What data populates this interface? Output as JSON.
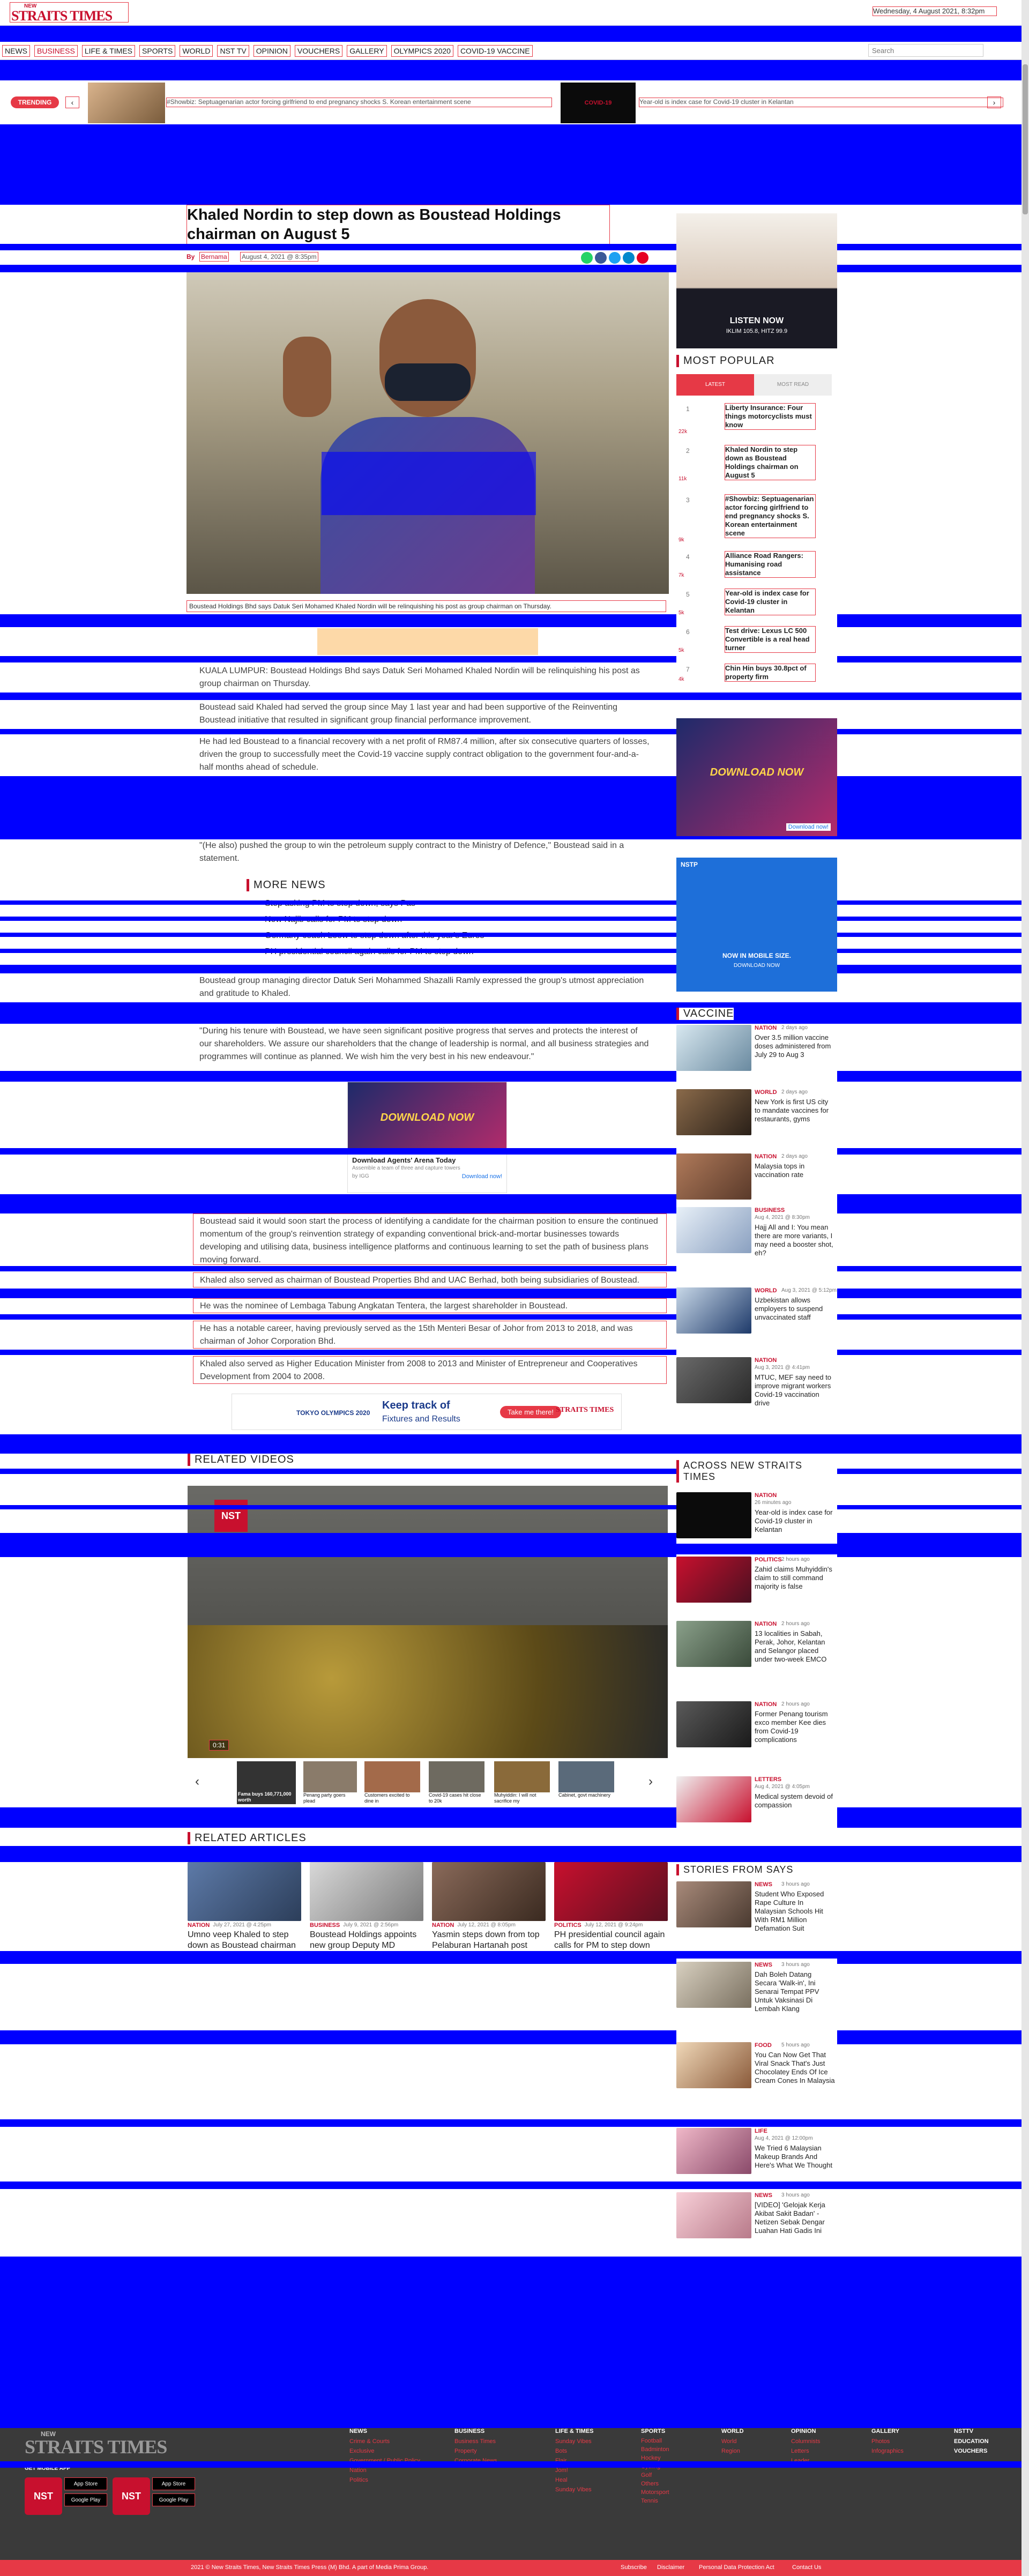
{
  "header": {
    "logo_top": "NEW",
    "logo_main": "STRAITS TIMES",
    "date": "Wednesday, 4 August 2021, 8:32pm"
  },
  "nav": {
    "items": [
      "NEWS",
      "BUSINESS",
      "LIFE & TIMES",
      "SPORTS",
      "WORLD",
      "NST TV",
      "OPINION",
      "VOUCHERS",
      "GALLERY",
      "OLYMPICS 2020",
      "COVID-19 VACCINE"
    ],
    "search_placeholder": "Search"
  },
  "trending": {
    "label": "TRENDING",
    "item1": "#Showbiz: Septuagenarian actor forcing girlfriend to end pregnancy shocks S. Korean entertainment scene",
    "item2": "Year-old is index case for Covid-19 cluster in Kelantan"
  },
  "article": {
    "title": "Khaled Nordin to step down as Boustead Holdings chairman on August 5",
    "byline_label": "By",
    "byline_author": "Bernama",
    "date": "August 4, 2021 @ 8:35pm",
    "caption": "Boustead Holdings Bhd says Datuk Seri Mohamed Khaled Nordin will be relinquishing his post as group chairman on Thursday.",
    "p1": "KUALA LUMPUR: Boustead Holdings Bhd says Datuk Seri Mohamed Khaled Nordin will be relinquishing his post as group chairman on Thursday.",
    "p2": "Boustead said Khaled had served the group since May 1 last year and had been supportive of the Reinventing Boustead initiative that resulted in significant group financial performance improvement.",
    "p3": "He had led Boustead to a financial recovery with a net profit of RM87.4 million, after six consecutive quarters of losses, driven the group to successfully meet the Covid-19 vaccine supply contract obligation to the government four-and-a-half months ahead of schedule.",
    "p4": "\"(He also) pushed the group to win the petroleum supply contract to the Ministry of Defence,\" Boustead said in a statement.",
    "p5": "Boustead group managing director Datuk Seri Mohammed Shazalli Ramly expressed the group's utmost appreciation and gratitude to Khaled.",
    "p6": "\"During his tenure with Boustead, we have seen significant positive progress that serves and protects the interest of our shareholders. We assure our shareholders that the change of leadership is normal, and all business strategies and programmes will continue as planned. We wish him the very best in his new endeavour.\"",
    "p7": "Boustead said it would soon start the process of identifying a candidate for the chairman position to ensure the continued momentum of the group's reinvention strategy of expanding conventional brick-and-mortar businesses towards developing and utilising data, business intelligence platforms and continuous learning to set the path of business plans moving forward.",
    "p8": "Khaled also served as chairman of Boustead Properties Bhd and UAC Berhad, both being subsidiaries of Boustead.",
    "p9": "He was the nominee of Lembaga Tabung Angkatan Tentera, the largest shareholder in Boustead.",
    "p10": "He has a notable career, having previously served as the 15th Menteri Besar of Johor from 2013 to 2018, and was chairman of Johor Corporation Bhd.",
    "p11": "Khaled also served as Higher Education Minister from 2008 to 2013 and Minister of Entrepreneur and Cooperatives Development from 2004 to 2008."
  },
  "more_news": {
    "title": "MORE NEWS",
    "items": [
      "Stop asking PM to step down, says Pas",
      "Now Najib calls for PM to step down",
      "Germany coach Loew to step down after this year's Euros",
      "PH presidential council again calls for PM to step down"
    ]
  },
  "ad_game": {
    "title": "Download Agents' Arena Today",
    "sub": "Assemble a team of three and capture towers",
    "brand": "by IGG",
    "cta": "Download now!",
    "banner": "DOWNLOAD NOW"
  },
  "olympics_banner": {
    "text1": "TOKYO OLYMPICS 2020",
    "text2": "Keep track of",
    "text3": "Fixtures and Results",
    "cta": "Take me there!"
  },
  "related_videos": {
    "title": "RELATED VIDEOS",
    "video_time": "0:31",
    "thumbs": [
      "Fama buys 160,771,000 worth",
      "Penang party goers plead",
      "Customers excited to dine in",
      "Covid-19 cases hit close to 20k",
      "Muhyiddin: I will not sacrifice my",
      "Cabinet, govt machinery"
    ]
  },
  "related_articles": {
    "title": "RELATED ARTICLES",
    "items": [
      {
        "cat": "NATION",
        "date": "July 27, 2021 @ 4:25pm",
        "title": "Umno veep Khaled to step down as Boustead chairman"
      },
      {
        "cat": "BUSINESS",
        "date": "July 9, 2021 @ 2:56pm",
        "title": "Boustead Holdings appoints new group Deputy MD"
      },
      {
        "cat": "NATION",
        "date": "July 12, 2021 @ 8:05pm",
        "title": "Yasmin steps down from top Pelaburan Hartanah post"
      },
      {
        "cat": "POLITICS",
        "date": "July 12, 2021 @ 9:24pm",
        "title": "PH presidential council again calls for PM to step down"
      }
    ]
  },
  "sidebar": {
    "listen_title": "LISTEN NOW",
    "listen_sub": "IKLIM 105.8, HITZ 99.9",
    "most_popular": {
      "title": "MOST POPULAR",
      "tab1": "LATEST",
      "tab2": "MOST READ",
      "items": [
        {
          "n": "1",
          "views": "22k",
          "title": "Liberty Insurance: Four things motorcyclists must know"
        },
        {
          "n": "2",
          "views": "11k",
          "title": "Khaled Nordin to step down as Boustead Holdings chairman on August 5"
        },
        {
          "n": "3",
          "views": "9k",
          "title": "#Showbiz: Septuagenarian actor forcing girlfriend to end pregnancy shocks S. Korean entertainment scene"
        },
        {
          "n": "4",
          "views": "7k",
          "title": "Alliance Road Rangers: Humanising road assistance"
        },
        {
          "n": "5",
          "views": "5k",
          "title": "Year-old is index case for Covid-19 cluster in Kelantan"
        },
        {
          "n": "6",
          "views": "5k",
          "title": "Test drive: Lexus LC 500 Convertible is a real head turner"
        },
        {
          "n": "7",
          "views": "4k",
          "title": "Chin Hin buys 30.8pct of property firm"
        }
      ]
    },
    "nstp_ad": {
      "line1": "NOW IN MOBILE SIZE.",
      "line2": "DOWNLOAD NOW",
      "brand": "NSTP"
    },
    "vaccine": {
      "title": "VACCINE",
      "items": [
        {
          "cat": "NATION",
          "date": "2 days ago",
          "title": "Over 3.5 million vaccine doses administered from July 29 to Aug 3"
        },
        {
          "cat": "WORLD",
          "date": "2 days ago",
          "title": "New York is first US city to mandate vaccines for restaurants, gyms"
        },
        {
          "cat": "NATION",
          "date": "2 days ago",
          "title": "Malaysia tops in vaccination rate"
        },
        {
          "cat": "BUSINESS",
          "date": "Aug 4, 2021 @ 8:30pm",
          "title": "Hajj All and I: You mean there are more variants, I may need a booster shot, eh?"
        },
        {
          "cat": "WORLD",
          "date": "Aug 3, 2021 @ 5:12pm",
          "title": "Uzbekistan allows employers to suspend unvaccinated staff"
        },
        {
          "cat": "NATION",
          "date": "Aug 3, 2021 @ 4:41pm",
          "title": "MTUC, MEF say need to improve migrant workers Covid-19 vaccination drive"
        }
      ]
    },
    "across": {
      "title": "ACROSS NEW STRAITS TIMES",
      "items": [
        {
          "cat": "NATION",
          "date": "26 minutes ago",
          "title": "Year-old is index case for Covid-19 cluster in Kelantan"
        },
        {
          "cat": "POLITICS",
          "date": "2 hours ago",
          "title": "Zahid claims Muhyiddin's claim to still command majority is false"
        },
        {
          "cat": "NATION",
          "date": "2 hours ago",
          "title": "13 localities in Sabah, Perak, Johor, Kelantan and Selangor placed under two-week EMCO"
        },
        {
          "cat": "NATION",
          "date": "2 hours ago",
          "title": "Former Penang tourism exco member Kee dies from Covid-19 complications"
        },
        {
          "cat": "LETTERS",
          "date": "Aug 4, 2021 @ 4:05pm",
          "title": "Medical system devoid of compassion"
        }
      ]
    },
    "stories": {
      "title": "STORIES FROM SAYS",
      "items": [
        {
          "cat": "NEWS",
          "date": "3 hours ago",
          "title": "Student Who Exposed Rape Culture In Malaysian Schools Hit With RM1 Million Defamation Suit"
        },
        {
          "cat": "NEWS",
          "date": "3 hours ago",
          "title": "Dah Boleh Datang Secara 'Walk-in', Ini Senarai Tempat PPV Untuk Vaksinasi Di Lembah Klang"
        },
        {
          "cat": "FOOD",
          "date": "5 hours ago",
          "title": "You Can Now Get That Viral Snack That's Just Chocolatey Ends Of Ice Cream Cones In Malaysia"
        },
        {
          "cat": "LIFE",
          "date": "Aug 4, 2021 @ 12:00pm",
          "title": "We Tried 6 Malaysian Makeup Brands And Here's What We Thought"
        },
        {
          "cat": "NEWS",
          "date": "3 hours ago",
          "title": "[VIDEO] 'Gelojak Kerja Akibat Sakit Badan' - Netizen Sebak Dengar Luahan Hati Gadis Ini"
        }
      ]
    }
  },
  "footer": {
    "logo_top": "NEW",
    "logo_main": "STRAITS TIMES",
    "get_mobile": "GET MOBILE APP",
    "cols": [
      {
        "head": "NEWS",
        "items": [
          "Crime & Courts",
          "Exclusive",
          "Government / Public Policy",
          "Nation",
          "Politics"
        ]
      },
      {
        "head": "BUSINESS",
        "items": [
          "Business Times",
          "Property",
          "Corporate News"
        ]
      },
      {
        "head": "LIFE & TIMES",
        "items": [
          "Sunday Vibes",
          "Bots",
          "Flair",
          "Jom!",
          "Heal",
          "Sunday Vibes"
        ]
      },
      {
        "head": "SPORTS",
        "items": [
          "Football",
          "Badminton",
          "Hockey",
          "Cycling",
          "Golf",
          "Others",
          "Motorsport",
          "Tennis"
        ]
      },
      {
        "head": "WORLD",
        "items": [
          "World",
          "Region"
        ]
      },
      {
        "head": "OPINION",
        "items": [
          "Columnists",
          "Letters",
          "Leader"
        ]
      },
      {
        "head": "GALLERY",
        "items": [
          "Photos",
          "Infographics"
        ]
      },
      {
        "head": "NSTTV",
        "items": [
          "EDUCATION",
          "VOUCHERS"
        ]
      }
    ],
    "app_store": "App Store",
    "google_play": "Google Play",
    "copyright": "2021 © New Straits Times, New Straits Times Press (M) Bhd. A part of Media Prima Group.",
    "links": [
      "Subscribe",
      "Disclaimer",
      "Personal Data Protection Act",
      "Contact Us"
    ]
  }
}
